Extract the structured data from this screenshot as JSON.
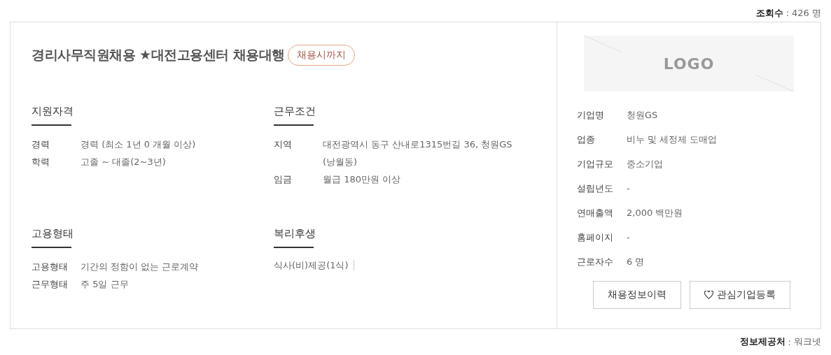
{
  "view_count": {
    "label": "조회수",
    "separator": ":",
    "value": "426 명"
  },
  "job": {
    "title": "경리사무직원채용 ★대전고용센터 채용대행",
    "deadline_badge": "채용시까지"
  },
  "sections": [
    {
      "kind": "pairs",
      "heading": "지원자격",
      "rows": [
        {
          "label": "경력",
          "value": "경력 (최소 1년 0 개월 이상)"
        },
        {
          "label": "학력",
          "value": "고졸 ~ 대졸(2~3년)"
        }
      ]
    },
    {
      "kind": "pairs",
      "heading": "근무조건",
      "rows": [
        {
          "label": "지역",
          "value": "대전광역시 동구 산내로1315번길 36, 청원GS (낭월동)"
        },
        {
          "label": "임금",
          "value": "월급 180만원 이상"
        }
      ]
    },
    {
      "kind": "pairs",
      "heading": "고용형태",
      "rows": [
        {
          "label": "고용형태",
          "value": "기간의 정함이 없는 근로계약"
        },
        {
          "label": "근무형태",
          "value": "주 5일 근무"
        }
      ]
    },
    {
      "kind": "list",
      "heading": "복리후생",
      "items": [
        "식사(비)제공(1식)"
      ]
    }
  ],
  "company": {
    "logo_placeholder": "LOGO",
    "info": [
      {
        "label": "기업명",
        "value": "청원GS"
      },
      {
        "label": "업종",
        "value": "비누 및 세정제 도매업"
      },
      {
        "label": "기업규모",
        "value": "중소기업"
      },
      {
        "label": "설립년도",
        "value": "-"
      },
      {
        "label": "연매출액",
        "value": "2,000 백만원"
      },
      {
        "label": "홈페이지",
        "value": "-"
      },
      {
        "label": "근로자수",
        "value": "6 명"
      }
    ],
    "buttons": [
      {
        "kind": "plain",
        "label": "채용정보이력"
      },
      {
        "kind": "favorite",
        "label": "관심기업등록"
      }
    ]
  },
  "source": {
    "label": "정보제공처",
    "separator": ":",
    "value": "워크넷"
  }
}
